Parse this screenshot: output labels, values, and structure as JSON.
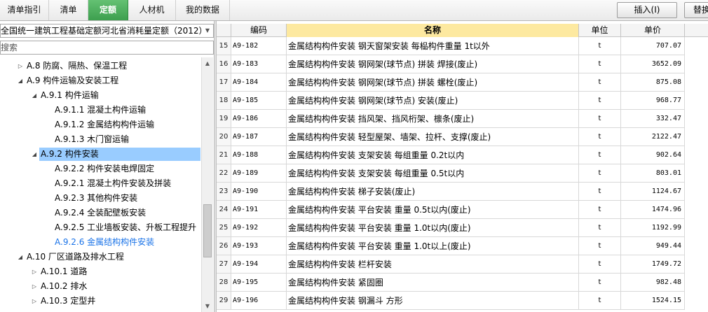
{
  "tabs": [
    {
      "label": "清单指引",
      "active": false
    },
    {
      "label": "清单",
      "active": false
    },
    {
      "label": "定额",
      "active": true
    },
    {
      "label": "人材机",
      "active": false
    },
    {
      "label": "我的数据",
      "active": false
    }
  ],
  "toolbar": {
    "insert_label": "插入(I)",
    "replace_label": "替换"
  },
  "library_select": {
    "value": "全国统一建筑工程基础定额河北省消耗量定额（2012）"
  },
  "search": {
    "placeholder": "搜索"
  },
  "tree": [
    {
      "label": "A.8 防腐、隔热、保温工程",
      "arrow": "▷",
      "level": 0
    },
    {
      "label": "A.9 构件运输及安装工程",
      "arrow": "◢",
      "level": 0
    },
    {
      "label": "A.9.1 构件运输",
      "arrow": "◢",
      "level": 1
    },
    {
      "label": "A.9.1.1 混凝土构件运输",
      "arrow": "",
      "level": 2
    },
    {
      "label": "A.9.1.2 金属结构构件运输",
      "arrow": "",
      "level": 2
    },
    {
      "label": "A.9.1.3 木门窗运输",
      "arrow": "",
      "level": 2
    },
    {
      "label": "A.9.2 构件安装",
      "arrow": "◢",
      "level": 1,
      "selected": true
    },
    {
      "label": "A.9.2.2 构件安装电焊固定",
      "arrow": "",
      "level": 2
    },
    {
      "label": "A.9.2.1 混凝土构件安装及拼装",
      "arrow": "",
      "level": 2
    },
    {
      "label": "A.9.2.3 其他构件安装",
      "arrow": "",
      "level": 2
    },
    {
      "label": "A.9.2.4 全装配壁板安装",
      "arrow": "",
      "level": 2
    },
    {
      "label": "A.9.2.5 工业墙板安装、升板工程提升",
      "arrow": "",
      "level": 2
    },
    {
      "label": "A.9.2.6 金属结构构件安装",
      "arrow": "",
      "level": 2,
      "link": true
    },
    {
      "label": "A.10 厂区道路及排水工程",
      "arrow": "◢",
      "level": 0
    },
    {
      "label": "A.10.1 道路",
      "arrow": "▷",
      "level": 1
    },
    {
      "label": "A.10.2 排水",
      "arrow": "▷",
      "level": 1
    },
    {
      "label": "A.10.3 定型井",
      "arrow": "▷",
      "level": 1
    }
  ],
  "scrollbar": {
    "up": "▲",
    "down": "▼"
  },
  "grid": {
    "headers": {
      "code": "编码",
      "name": "名称",
      "unit": "单位",
      "price": "单价"
    },
    "rows": [
      {
        "idx": "15",
        "code": "A9-182",
        "name": "金属结构构件安装 钢天窗架安装 每榀构件重量 1t以外",
        "unit": "t",
        "price": "707.07"
      },
      {
        "idx": "16",
        "code": "A9-183",
        "name": "金属结构构件安装 钢网架(球节点) 拼装 焊接(废止)",
        "unit": "t",
        "price": "3652.09"
      },
      {
        "idx": "17",
        "code": "A9-184",
        "name": "金属结构构件安装 钢网架(球节点) 拼装 螺栓(废止)",
        "unit": "t",
        "price": "875.08"
      },
      {
        "idx": "18",
        "code": "A9-185",
        "name": "金属结构构件安装 钢网架(球节点) 安装(废止)",
        "unit": "t",
        "price": "968.77"
      },
      {
        "idx": "19",
        "code": "A9-186",
        "name": "金属结构构件安装 挡风架、挡风桁架、檩条(废止)",
        "unit": "t",
        "price": "332.47"
      },
      {
        "idx": "20",
        "code": "A9-187",
        "name": "金属结构构件安装 轻型屋架、墙架、拉杆、支撑(废止)",
        "unit": "t",
        "price": "2122.47"
      },
      {
        "idx": "21",
        "code": "A9-188",
        "name": "金属结构构件安装 支架安装 每组重量 0.2t以内",
        "unit": "t",
        "price": "902.64"
      },
      {
        "idx": "22",
        "code": "A9-189",
        "name": "金属结构构件安装 支架安装 每组重量 0.5t以内",
        "unit": "t",
        "price": "803.01"
      },
      {
        "idx": "23",
        "code": "A9-190",
        "name": "金属结构构件安装 梯子安装(废止)",
        "unit": "t",
        "price": "1124.67"
      },
      {
        "idx": "24",
        "code": "A9-191",
        "name": "金属结构构件安装 平台安装 重量 0.5t以内(废止)",
        "unit": "t",
        "price": "1474.96"
      },
      {
        "idx": "25",
        "code": "A9-192",
        "name": "金属结构构件安装 平台安装 重量 1.0t以内(废止)",
        "unit": "t",
        "price": "1192.99"
      },
      {
        "idx": "26",
        "code": "A9-193",
        "name": "金属结构构件安装 平台安装 重量 1.0t以上(废止)",
        "unit": "t",
        "price": "949.44"
      },
      {
        "idx": "27",
        "code": "A9-194",
        "name": "金属结构构件安装 栏杆安装",
        "unit": "t",
        "price": "1749.72"
      },
      {
        "idx": "28",
        "code": "A9-195",
        "name": "金属结构构件安装 紧固圈",
        "unit": "t",
        "price": "982.48"
      },
      {
        "idx": "29",
        "code": "A9-196",
        "name": "金属结构构件安装 钢漏斗 方形",
        "unit": "t",
        "price": "1524.15"
      }
    ]
  }
}
